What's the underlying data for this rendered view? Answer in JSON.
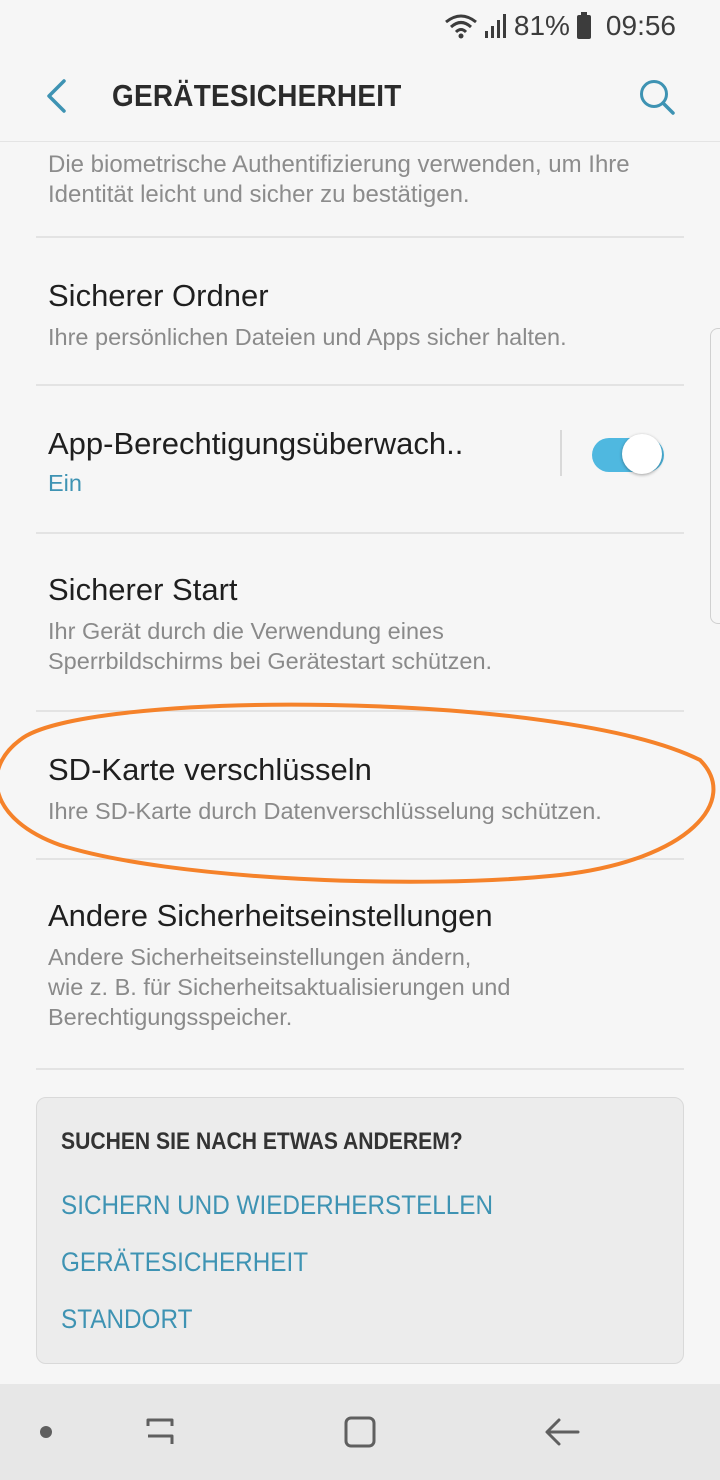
{
  "status_bar": {
    "battery_percent": "81%",
    "time": "09:56",
    "icons": [
      "wifi-icon",
      "signal-icon",
      "battery-icon"
    ]
  },
  "app_bar": {
    "title": "GERÄTESICHERHEIT",
    "icons": [
      "back-arrow-icon",
      "search-icon"
    ]
  },
  "intro_text": "Die biometrische Authentifizierung verwenden, um Ihre Identität leicht und sicher zu bestätigen.",
  "settings": [
    {
      "title": "Sicherer Ordner",
      "description": "Ihre persönlichen Dateien und Apps sicher halten."
    },
    {
      "title": "App-Berechtigungsüberwach..",
      "status": "Ein",
      "toggle_on": true
    },
    {
      "title": "Sicherer Start",
      "description": "Ihr Gerät durch die Verwendung eines\nSperrbildschirms bei Gerätestart schützen."
    },
    {
      "title": "SD-Karte verschlüsseln",
      "description": "Ihre SD-Karte durch Datenverschlüsselung schützen.",
      "highlighted": true
    },
    {
      "title": "Andere Sicherheitseinstellungen",
      "description": "Andere Sicherheitseinstellungen ändern,\nwie z. B. für Sicherheitsaktualisierungen und\nBerechtigungsspeicher."
    }
  ],
  "suggestions": {
    "heading": "SUCHEN SIE NACH ETWAS ANDEREM?",
    "links": [
      "SICHERN UND WIEDERHERSTELLEN",
      "GERÄTESICHERHEIT",
      "STANDORT"
    ]
  },
  "nav_bar": {
    "icons": [
      "dot-icon",
      "recents-icon",
      "home-icon",
      "back-icon"
    ]
  },
  "colors": {
    "accent": "#3e93b3",
    "toggle_track": "#4fb8e0",
    "highlight_ellipse": "#f5822a",
    "background": "#f6f6f6"
  }
}
